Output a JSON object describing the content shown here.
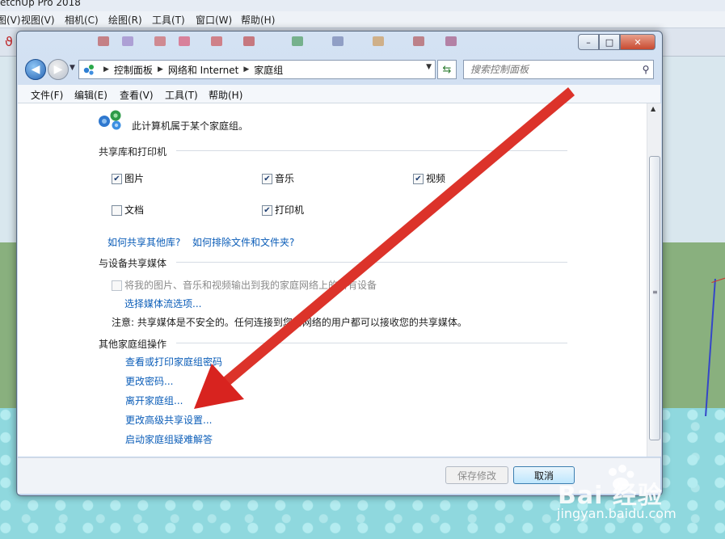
{
  "background_app": {
    "title": "etchUp Pro 2018",
    "menu": [
      "图(V)",
      "视图(V)",
      "相机(C)",
      "绘图(R)",
      "工具(T)",
      "窗口(W)",
      "帮助(H)"
    ]
  },
  "window": {
    "breadcrumbs": [
      "控制面板",
      "网络和 Internet",
      "家庭组"
    ],
    "search_placeholder": "搜索控制面板",
    "menu": [
      "文件(F)",
      "编辑(E)",
      "查看(V)",
      "工具(T)",
      "帮助(H)"
    ],
    "controls": {
      "minimize": "–",
      "maximize": "□",
      "close": "✕"
    }
  },
  "content": {
    "status_text": "此计算机属于某个家庭组。",
    "shared_section": {
      "title": "共享库和打印机",
      "items": [
        {
          "label": "图片",
          "checked": true
        },
        {
          "label": "音乐",
          "checked": true
        },
        {
          "label": "视频",
          "checked": true
        },
        {
          "label": "文档",
          "checked": false
        },
        {
          "label": "打印机",
          "checked": true
        }
      ],
      "links": [
        "如何共享其他库?",
        "如何排除文件和文件夹?"
      ]
    },
    "media_section": {
      "title": "与设备共享媒体",
      "stream_checkbox": {
        "label": "将我的图片、音乐和视频输出到我的家庭网络上的所有设备",
        "checked": false
      },
      "stream_link": "选择媒体流选项...",
      "note": "注意: 共享媒体是不安全的。任何连接到您的网络的用户都可以接收您的共享媒体。"
    },
    "other_section": {
      "title": "其他家庭组操作",
      "actions": [
        "查看或打印家庭组密码",
        "更改密码...",
        "离开家庭组...",
        "更改高级共享设置...",
        "启动家庭组疑难解答"
      ]
    }
  },
  "footer": {
    "save_label": "保存修改",
    "cancel_label": "取消"
  },
  "watermark": {
    "logo_text": "Bai 经验",
    "url": "jingyan.baidu.com"
  },
  "colors": {
    "link": "#0b5db8",
    "arrow": "#e32622",
    "window_frame": "#c9dbf0"
  }
}
